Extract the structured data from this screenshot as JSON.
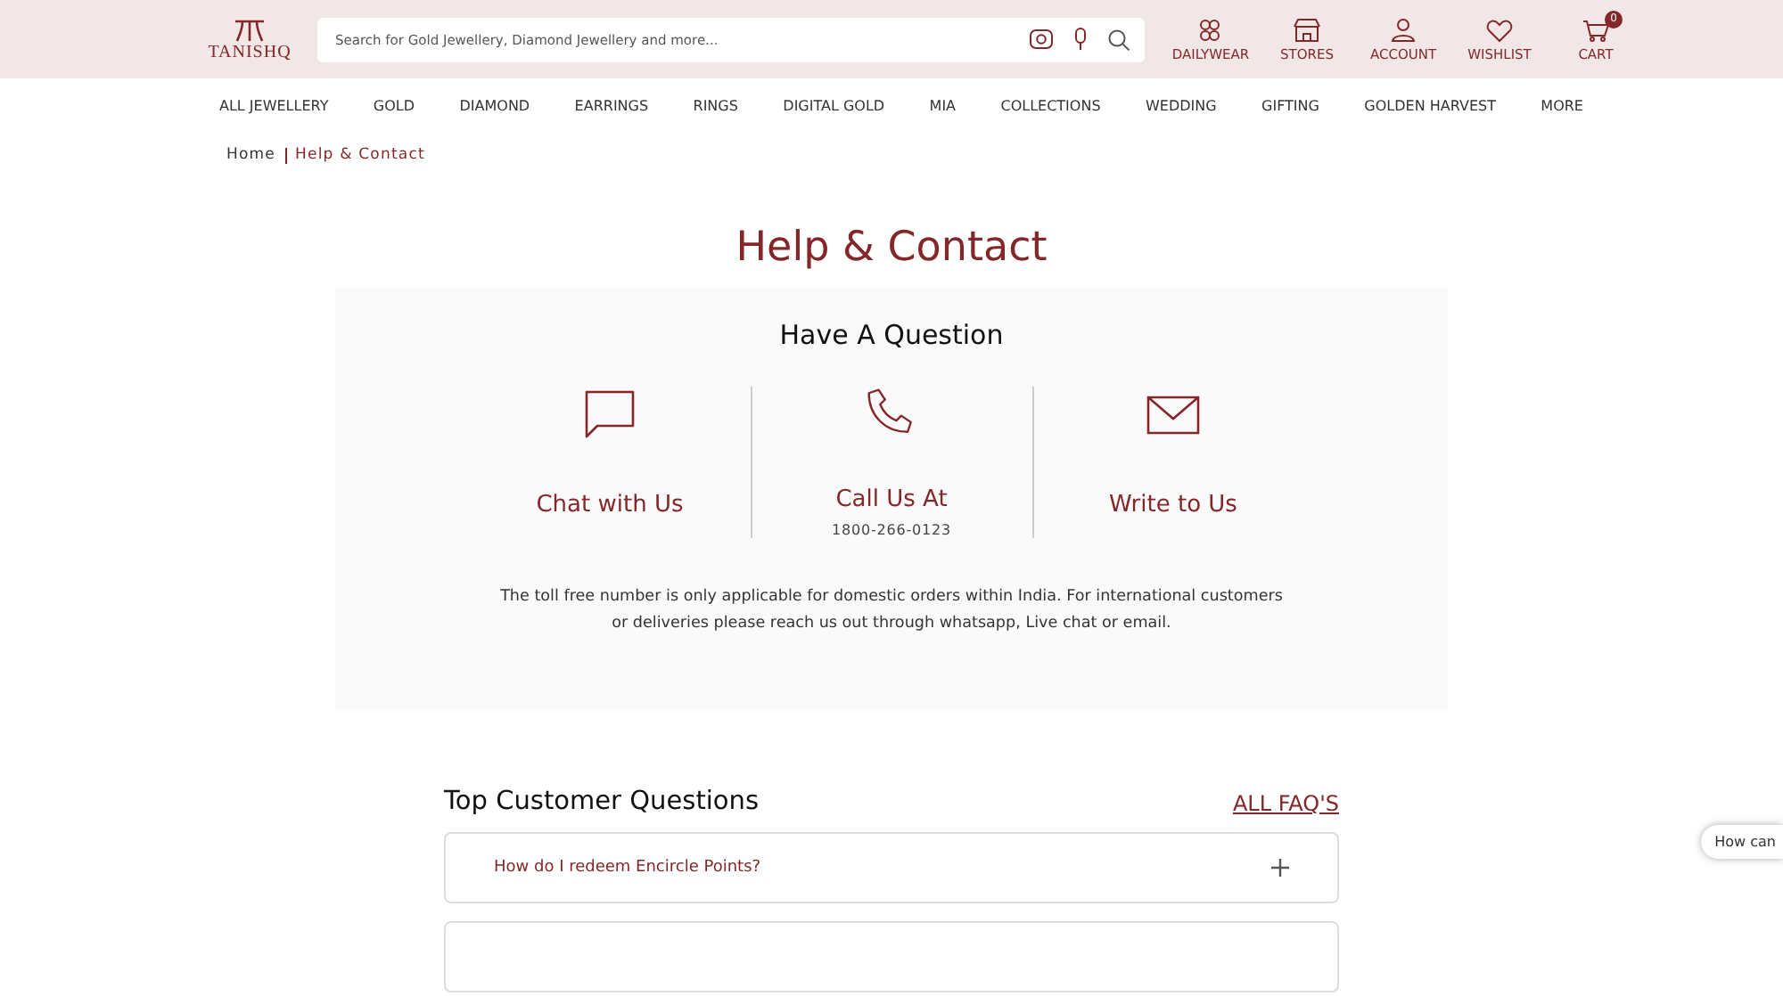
{
  "header": {
    "logo": "TANISHQ",
    "search": {
      "placeholder": "Search for Gold Jewellery, Diamond Jewellery and more..."
    },
    "actions": [
      {
        "kind": "dailywear",
        "label": "DAILYWEAR"
      },
      {
        "kind": "stores",
        "label": "STORES"
      },
      {
        "kind": "account",
        "label": "ACCOUNT"
      },
      {
        "kind": "wishlist",
        "label": "WISHLIST"
      },
      {
        "kind": "cart",
        "label": "CART",
        "count": "0"
      }
    ]
  },
  "nav": [
    "ALL JEWELLERY",
    "GOLD",
    "DIAMOND",
    "EARRINGS",
    "RINGS",
    "DIGITAL GOLD",
    "MIA",
    "COLLECTIONS",
    "WEDDING",
    "GIFTING",
    "GOLDEN HARVEST",
    "MORE"
  ],
  "breadcrumb": [
    "Home",
    "Help & Contact"
  ],
  "title": "Help & Contact",
  "contact": {
    "heading": "Have A Question",
    "options": [
      {
        "kind": "chat",
        "label": "Chat with Us"
      },
      {
        "kind": "call",
        "label": "Call Us At",
        "detail": "1800-266-0123"
      },
      {
        "kind": "mail",
        "label": "Write to Us"
      }
    ],
    "note": "The toll free number is only applicable for domestic orders within India. For international customers or deliveries please reach us out through whatsapp, Live chat or email."
  },
  "faq": {
    "heading": "Top Customer Questions",
    "link": "ALL FAQ'S",
    "items": [
      {
        "question": "How do I redeem Encircle Points?",
        "expanded": false
      }
    ]
  },
  "chat_bubble": "How can"
}
